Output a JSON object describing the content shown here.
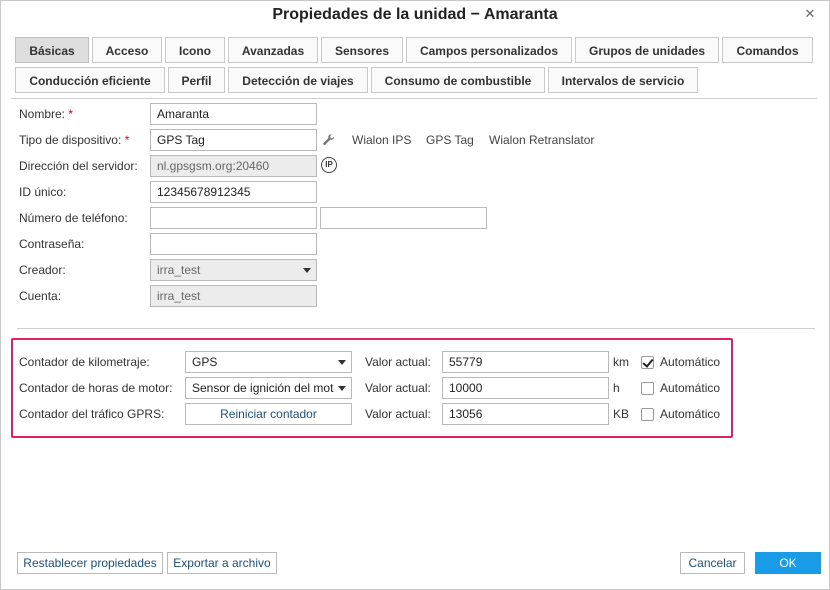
{
  "title": "Propiedades de la unidad − Amaranta",
  "tabs": [
    {
      "label": "Básicas",
      "active": true
    },
    {
      "label": "Acceso"
    },
    {
      "label": "Icono"
    },
    {
      "label": "Avanzadas"
    },
    {
      "label": "Sensores"
    },
    {
      "label": "Campos personalizados"
    },
    {
      "label": "Grupos de unidades"
    },
    {
      "label": "Comandos"
    },
    {
      "label": "Conducción eficiente"
    },
    {
      "label": "Perfil"
    },
    {
      "label": "Detección de viajes"
    },
    {
      "label": "Consumo de combustible"
    },
    {
      "label": "Intervalos de servicio"
    }
  ],
  "form": {
    "name_label": "Nombre:",
    "name_value": "Amaranta",
    "device_type_label": "Tipo de dispositivo:",
    "device_type_value": "GPS Tag",
    "device_links": [
      "Wialon IPS",
      "GPS Tag",
      "Wialon Retranslator"
    ],
    "server_label": "Dirección del servidor:",
    "server_value": "nl.gpsgsm.org:20460",
    "ip_icon_text": "IP",
    "unique_id_label": "ID único:",
    "unique_id_value": "12345678912345",
    "phone_label": "Número de teléfono:",
    "phone_value_1": "",
    "phone_value_2": "",
    "password_label": "Contraseña:",
    "password_value": "",
    "creator_label": "Creador:",
    "creator_value": "irra_test",
    "account_label": "Cuenta:",
    "account_value": "irra_test",
    "required_mark": "*"
  },
  "counters": {
    "mileage_label": "Contador de kilometraje:",
    "mileage_select": "GPS",
    "engine_label": "Contador de horas de motor:",
    "engine_select": "Sensor de ignición del mot",
    "gprs_label": "Contador del tráfico GPRS:",
    "gprs_button": "Reiniciar contador",
    "current_value_label": "Valor actual:",
    "mileage_value": "55779",
    "mileage_unit": "km",
    "engine_value": "10000",
    "engine_unit": "h",
    "gprs_value": "13056",
    "gprs_unit": "KB",
    "auto_label": "Automático",
    "mileage_auto": true,
    "engine_auto": false,
    "gprs_auto": false
  },
  "footer": {
    "reset_label": "Restablecer propiedades",
    "export_label": "Exportar a archivo",
    "cancel_label": "Cancelar",
    "ok_label": "OK"
  },
  "colors": {
    "highlight": "#e0215f",
    "ok_button": "#1a9be8",
    "required": "#d0021b"
  }
}
